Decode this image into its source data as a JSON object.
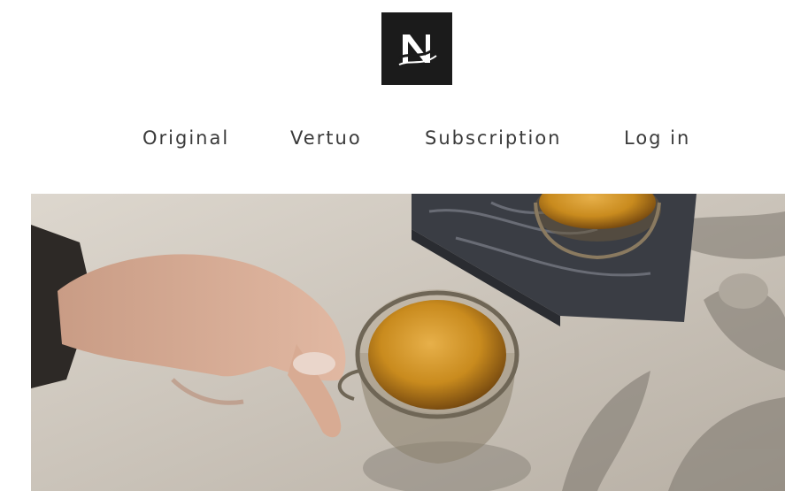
{
  "brand": {
    "logo_letter": "N",
    "logo_bg": "#1b1b1b"
  },
  "nav": {
    "items": [
      {
        "label": "Original"
      },
      {
        "label": "Vertuo"
      },
      {
        "label": "Subscription"
      },
      {
        "label": "Log in"
      }
    ]
  },
  "hero": {
    "accent_espresso": "#c98b1e"
  }
}
